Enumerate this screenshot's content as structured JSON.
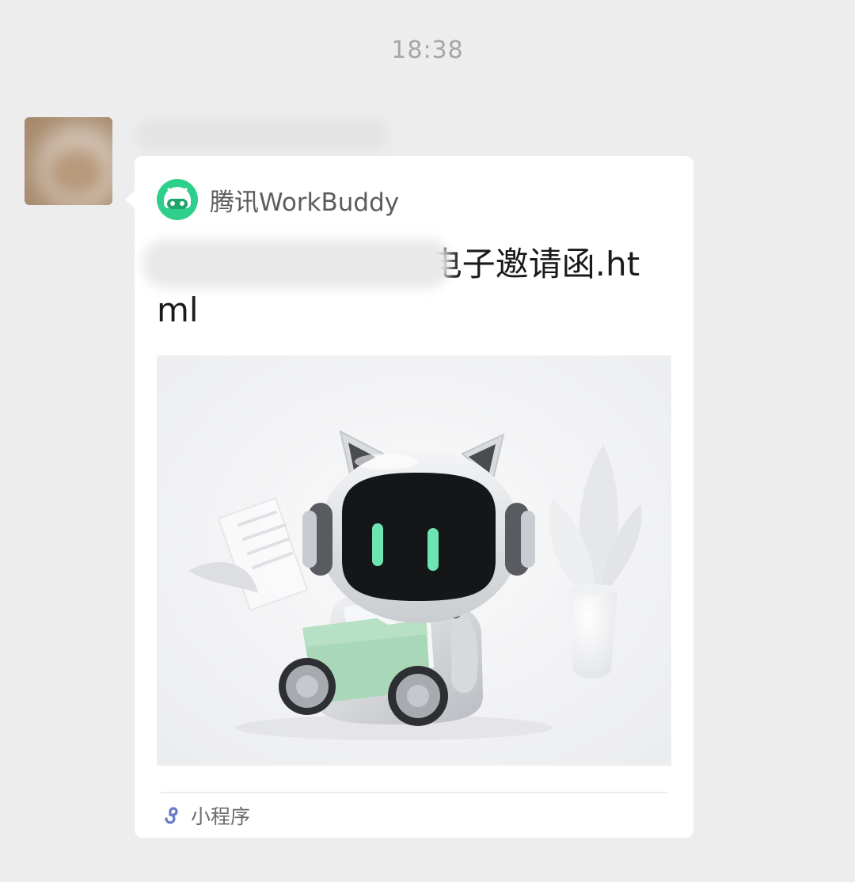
{
  "chat": {
    "timestamp": "18:38"
  },
  "message": {
    "card": {
      "app_name": "腾讯WorkBuddy",
      "app_icon": "workbuddy-logo-icon",
      "title": "vi                    ",
      "title_visible_tail": "2 电子邀请函.html",
      "preview_image": "robot-cat-mascot-holding-green-folder",
      "footer_icon": "mini-program-icon",
      "footer_label": "小程序"
    }
  },
  "colors": {
    "background": "#ededed",
    "card": "#ffffff",
    "brand_green": "#2ecf8a",
    "mini_program_blue": "#6a7bc7"
  }
}
